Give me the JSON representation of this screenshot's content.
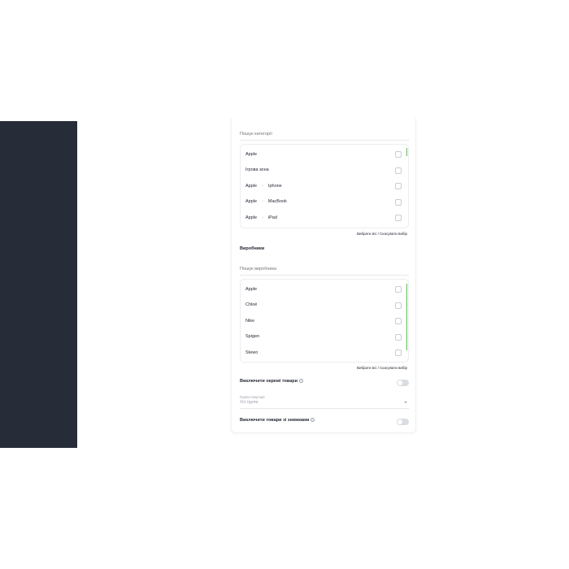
{
  "categories": {
    "search_placeholder": "Пошук категорії",
    "items": [
      {
        "parts": [
          "Apple"
        ]
      },
      {
        "parts": [
          "Ігрова зона"
        ]
      },
      {
        "parts": [
          "Apple",
          "Iphone"
        ]
      },
      {
        "parts": [
          "Apple",
          "MacBook"
        ]
      },
      {
        "parts": [
          "Apple",
          "iPad"
        ]
      }
    ],
    "select_all": "Вибрати всі",
    "divider": " / ",
    "clear": "Скасувати вибір"
  },
  "manufacturers": {
    "title": "Виробники",
    "search_placeholder": "Пошук виробника",
    "items": [
      "Apple",
      "Chloé",
      "Nike",
      "Spigen",
      "Stewo"
    ],
    "select_all": "Вибрати всі",
    "divider": " / ",
    "clear": "Скасувати вибір"
  },
  "exclude_products": {
    "label": "Виключити окремі товари",
    "info_icon": "i",
    "enabled": false
  },
  "buyer_groups": {
    "label": "Групи покупців",
    "value": "Усі групи"
  },
  "exclude_discounted": {
    "label": "Виключити товари зі знижками",
    "info_icon": "i",
    "enabled": false
  },
  "colors": {
    "sidebar": "#262d38",
    "scroll_accent": "#5fbf4d"
  }
}
